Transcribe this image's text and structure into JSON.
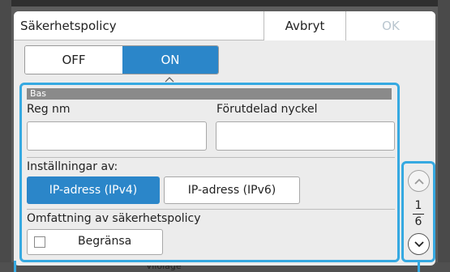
{
  "dialog": {
    "title": "Säkerhetspolicy",
    "cancel_label": "Avbryt",
    "ok_label": "OK",
    "toggle": {
      "off_label": "OFF",
      "on_label": "ON",
      "selected": "ON"
    }
  },
  "section": {
    "header": "Bas",
    "reg_name_label": "Reg nm",
    "reg_name_value": "",
    "psk_label": "Förutdelad nyckel",
    "psk_value": "",
    "settings_for_label": "Inställningar av:",
    "ipv4_label": "IP-adress (IPv4)",
    "ipv6_label": "IP-adress (IPv6)",
    "selected_ip": "IP-adress (IPv4)",
    "scope_label": "Omfattning av säkerhetspolicy",
    "limit_label": "Begränsa",
    "limit_checked": false
  },
  "pager": {
    "current": "1",
    "total": "6"
  },
  "background": {
    "bottom_text": "Vilolägе"
  },
  "colors": {
    "accent": "#2b86c9",
    "highlight": "#36a9e1",
    "disabled": "#b9c6cf"
  }
}
